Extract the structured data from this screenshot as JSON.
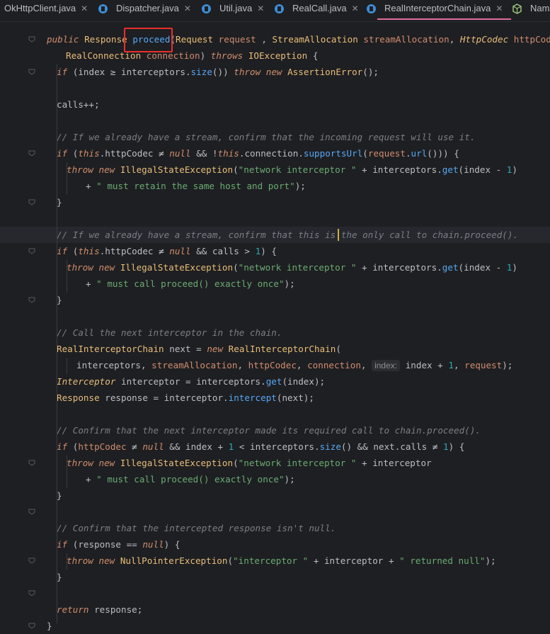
{
  "tabs": [
    {
      "label": "OkHttpClient.java",
      "close": "✕",
      "icon": "java-file-icon"
    },
    {
      "label": "Dispatcher.java",
      "close": "✕",
      "icon": "java-class-icon"
    },
    {
      "label": "Util.java",
      "close": "✕",
      "icon": "java-class-icon"
    },
    {
      "label": "RealCall.java",
      "close": "✕",
      "icon": "java-class-icon"
    },
    {
      "label": "RealInterceptorChain.java",
      "close": "✕",
      "icon": "java-class-icon",
      "active": true
    },
    {
      "label": "Nam",
      "icon": "java-interface-icon"
    }
  ],
  "code_lines": [
    [
      [
        "kw",
        "public "
      ],
      [
        "ty",
        "Response "
      ],
      [
        "fn",
        "proceed"
      ],
      [
        "",
        "("
      ],
      [
        "ty",
        "Request "
      ],
      [
        "par",
        "request"
      ],
      [
        "",
        " ,"
      ],
      [
        "ty",
        " StreamAllocation "
      ],
      [
        "par",
        "streamAllocation"
      ],
      [
        "",
        ", "
      ],
      [
        "itf",
        "HttpCodec "
      ],
      [
        "par",
        "httpCodec"
      ],
      [
        "",
        ","
      ]
    ],
    [
      [
        "ty",
        "RealConnection "
      ],
      [
        "par",
        "connection"
      ],
      [
        "",
        ") "
      ],
      [
        "kw",
        "throws "
      ],
      [
        "ty",
        "IOException "
      ],
      [
        "",
        "{"
      ]
    ],
    [
      [
        "kw",
        "if "
      ],
      [
        "",
        "(index "
      ],
      [
        "",
        "≥ "
      ],
      [
        "",
        "interceptors."
      ],
      [
        "call",
        "size"
      ],
      [
        "",
        "()) "
      ],
      [
        "kw",
        "throw new "
      ],
      [
        "ty",
        "AssertionError"
      ],
      [
        "",
        "();"
      ]
    ],
    [],
    [
      [
        "",
        "calls++;"
      ]
    ],
    [],
    [
      [
        "cm",
        "// If we already have a stream, confirm that the incoming request will use it."
      ]
    ],
    [
      [
        "kw",
        "if "
      ],
      [
        "",
        "("
      ],
      [
        "kw",
        "this"
      ],
      [
        "",
        ".httpCodec ≠ "
      ],
      [
        "kw",
        "null "
      ],
      [
        "",
        "&& !"
      ],
      [
        "kw",
        "this"
      ],
      [
        "",
        ".connection."
      ],
      [
        "call",
        "supportsUrl"
      ],
      [
        "",
        "("
      ],
      [
        "par",
        "request"
      ],
      [
        "",
        "."
      ],
      [
        "call",
        "url"
      ],
      [
        "",
        "())) {"
      ]
    ],
    [
      [
        "kw",
        "throw new "
      ],
      [
        "ty",
        "IllegalStateException"
      ],
      [
        "",
        "("
      ],
      [
        "str",
        "\"network interceptor \" "
      ],
      [
        "",
        "+ interceptors."
      ],
      [
        "call",
        "get"
      ],
      [
        "",
        "(index - "
      ],
      [
        "num",
        "1"
      ],
      [
        "",
        ")"
      ]
    ],
    [
      [
        "",
        "+ "
      ],
      [
        "str",
        "\" must retain the same host and port\""
      ],
      [
        "",
        ");"
      ]
    ],
    [
      [
        "",
        "}"
      ]
    ],
    [],
    [
      [
        "cm",
        "// If we already have a stream, confirm that this is the only call to chain.proceed()."
      ]
    ],
    [
      [
        "kw",
        "if "
      ],
      [
        "",
        "("
      ],
      [
        "kw",
        "this"
      ],
      [
        "",
        ".httpCodec ≠ "
      ],
      [
        "kw",
        "null "
      ],
      [
        "",
        "&& calls > "
      ],
      [
        "num",
        "1"
      ],
      [
        "",
        ") {"
      ]
    ],
    [
      [
        "kw",
        "throw new "
      ],
      [
        "ty",
        "IllegalStateException"
      ],
      [
        "",
        "("
      ],
      [
        "str",
        "\"network interceptor \" "
      ],
      [
        "",
        "+ interceptors."
      ],
      [
        "call",
        "get"
      ],
      [
        "",
        "(index - "
      ],
      [
        "num",
        "1"
      ],
      [
        "",
        ")"
      ]
    ],
    [
      [
        "",
        "+ "
      ],
      [
        "str",
        "\" must call proceed() exactly once\""
      ],
      [
        "",
        ");"
      ]
    ],
    [
      [
        "",
        "}"
      ]
    ],
    [],
    [
      [
        "cm",
        "// Call the next interceptor in the chain."
      ]
    ],
    [
      [
        "ty",
        "RealInterceptorChain "
      ],
      [
        "",
        "next = "
      ],
      [
        "kw",
        "new "
      ],
      [
        "ty",
        "RealInterceptorChain"
      ],
      [
        "",
        "("
      ]
    ],
    [
      [
        "",
        "interceptors, "
      ],
      [
        "par",
        "streamAllocation"
      ],
      [
        "",
        ", "
      ],
      [
        "par",
        "httpCodec"
      ],
      [
        "",
        ", "
      ],
      [
        "par",
        "connection"
      ],
      [
        "",
        ", "
      ],
      [
        "hint",
        "index:"
      ],
      [
        "",
        " index + "
      ],
      [
        "num",
        "1"
      ],
      [
        "",
        ", "
      ],
      [
        "par",
        "request"
      ],
      [
        "",
        ");"
      ]
    ],
    [
      [
        "itf",
        "Interceptor "
      ],
      [
        "",
        "interceptor = interceptors."
      ],
      [
        "call",
        "get"
      ],
      [
        "",
        "(index);"
      ]
    ],
    [
      [
        "ty",
        "Response "
      ],
      [
        "",
        "response = interceptor."
      ],
      [
        "call",
        "intercept"
      ],
      [
        "",
        "(next);"
      ]
    ],
    [],
    [
      [
        "cm",
        "// Confirm that the next interceptor made its required call to chain.proceed()."
      ]
    ],
    [
      [
        "kw",
        "if "
      ],
      [
        "",
        "("
      ],
      [
        "par",
        "httpCodec "
      ],
      [
        "",
        "≠ "
      ],
      [
        "kw",
        "null "
      ],
      [
        "",
        "&& index + "
      ],
      [
        "num",
        "1 "
      ],
      [
        "",
        "< interceptors."
      ],
      [
        "call",
        "size"
      ],
      [
        "",
        "() && next.calls ≠ "
      ],
      [
        "num",
        "1"
      ],
      [
        "",
        ") {"
      ]
    ],
    [
      [
        "kw",
        "throw new "
      ],
      [
        "ty",
        "IllegalStateException"
      ],
      [
        "",
        "("
      ],
      [
        "str",
        "\"network interceptor \" "
      ],
      [
        "",
        "+ interceptor"
      ]
    ],
    [
      [
        "",
        "+ "
      ],
      [
        "str",
        "\" must call proceed() exactly once\""
      ],
      [
        "",
        ");"
      ]
    ],
    [
      [
        "",
        "}"
      ]
    ],
    [],
    [
      [
        "cm",
        "// Confirm that the intercepted response isn't null."
      ]
    ],
    [
      [
        "kw",
        "if "
      ],
      [
        "",
        "(response == "
      ],
      [
        "kw",
        "null"
      ],
      [
        "",
        ") {"
      ]
    ],
    [
      [
        "kw",
        "throw new "
      ],
      [
        "ty",
        "NullPointerException"
      ],
      [
        "",
        "("
      ],
      [
        "str",
        "\"interceptor \" "
      ],
      [
        "",
        "+ interceptor + "
      ],
      [
        "str",
        "\" returned null\""
      ],
      [
        "",
        ");"
      ]
    ],
    [
      [
        "",
        "}"
      ]
    ],
    [],
    [
      [
        "kw",
        "return "
      ],
      [
        "",
        "response;"
      ]
    ],
    [
      [
        "",
        "}"
      ]
    ]
  ]
}
